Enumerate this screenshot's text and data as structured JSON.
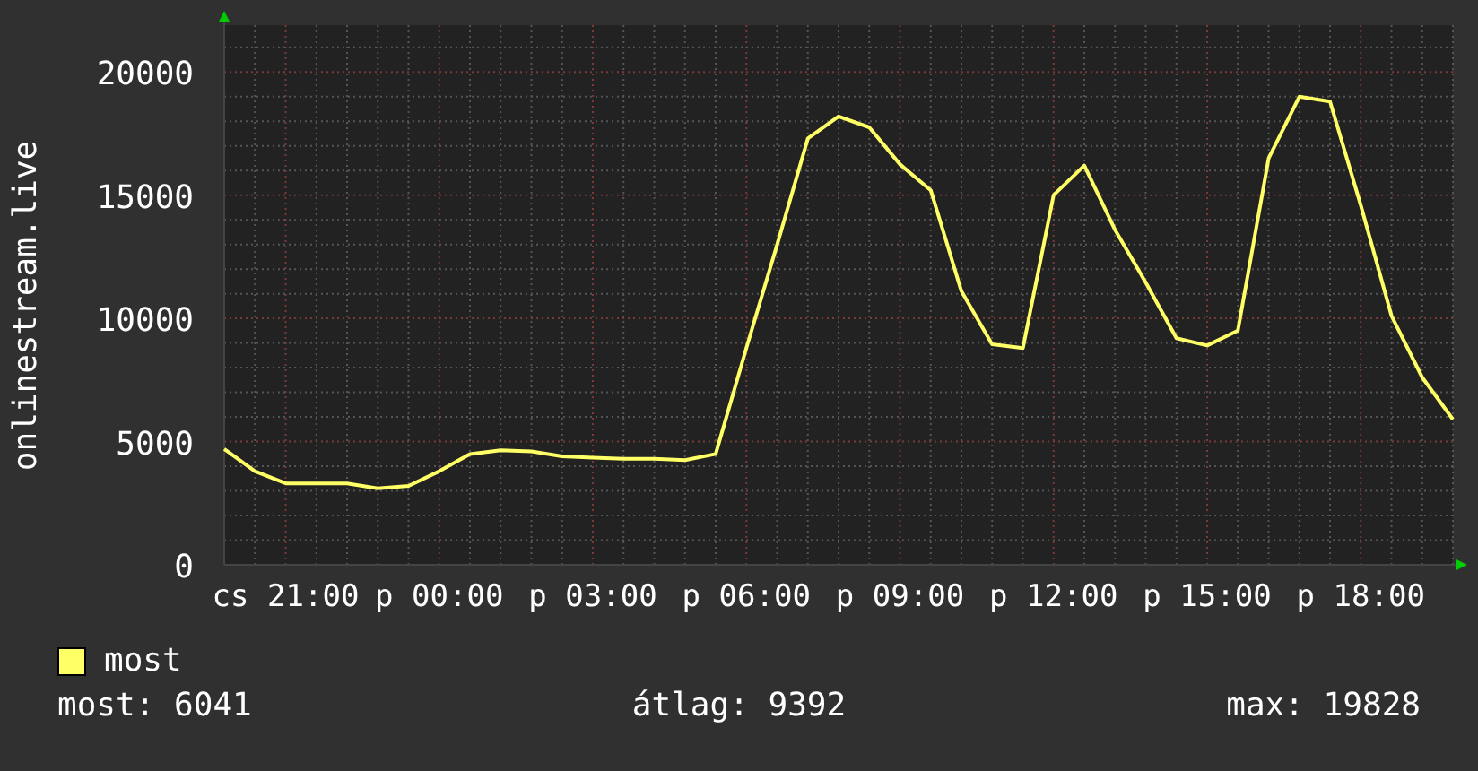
{
  "chart_data": {
    "type": "line",
    "ylabel": "onlinestream.live",
    "grid": true,
    "categories": [
      null,
      null,
      "cs 21:00",
      null,
      null,
      null,
      null,
      "p 00:00",
      null,
      null,
      null,
      null,
      "p 03:00",
      null,
      null,
      null,
      null,
      "p 06:00",
      null,
      null,
      null,
      null,
      "p 09:00",
      null,
      null,
      null,
      null,
      "p 12:00",
      null,
      null,
      null,
      null,
      "p 15:00",
      null,
      null,
      null,
      null,
      "p 18:00",
      null,
      null,
      null
    ],
    "series": [
      {
        "name": "most",
        "color": "#ffff66",
        "values": [
          4700,
          3800,
          3300,
          3300,
          3300,
          3100,
          3200,
          3800,
          4500,
          4650,
          4600,
          4400,
          4350,
          4300,
          4300,
          4250,
          4500,
          8800,
          13000,
          17300,
          18200,
          17750,
          16250,
          15200,
          11100,
          8950,
          8800,
          15000,
          16200,
          13600,
          11450,
          9200,
          8900,
          9500,
          16500,
          19000,
          18800,
          14600,
          10100,
          7600,
          5900
        ]
      }
    ],
    "ylim": [
      0,
      21900
    ],
    "yticks": [
      0,
      5000,
      10000,
      15000,
      20000
    ]
  },
  "stats": [
    "most: 6041",
    "átlag: 9392",
    "max: 19828"
  ]
}
